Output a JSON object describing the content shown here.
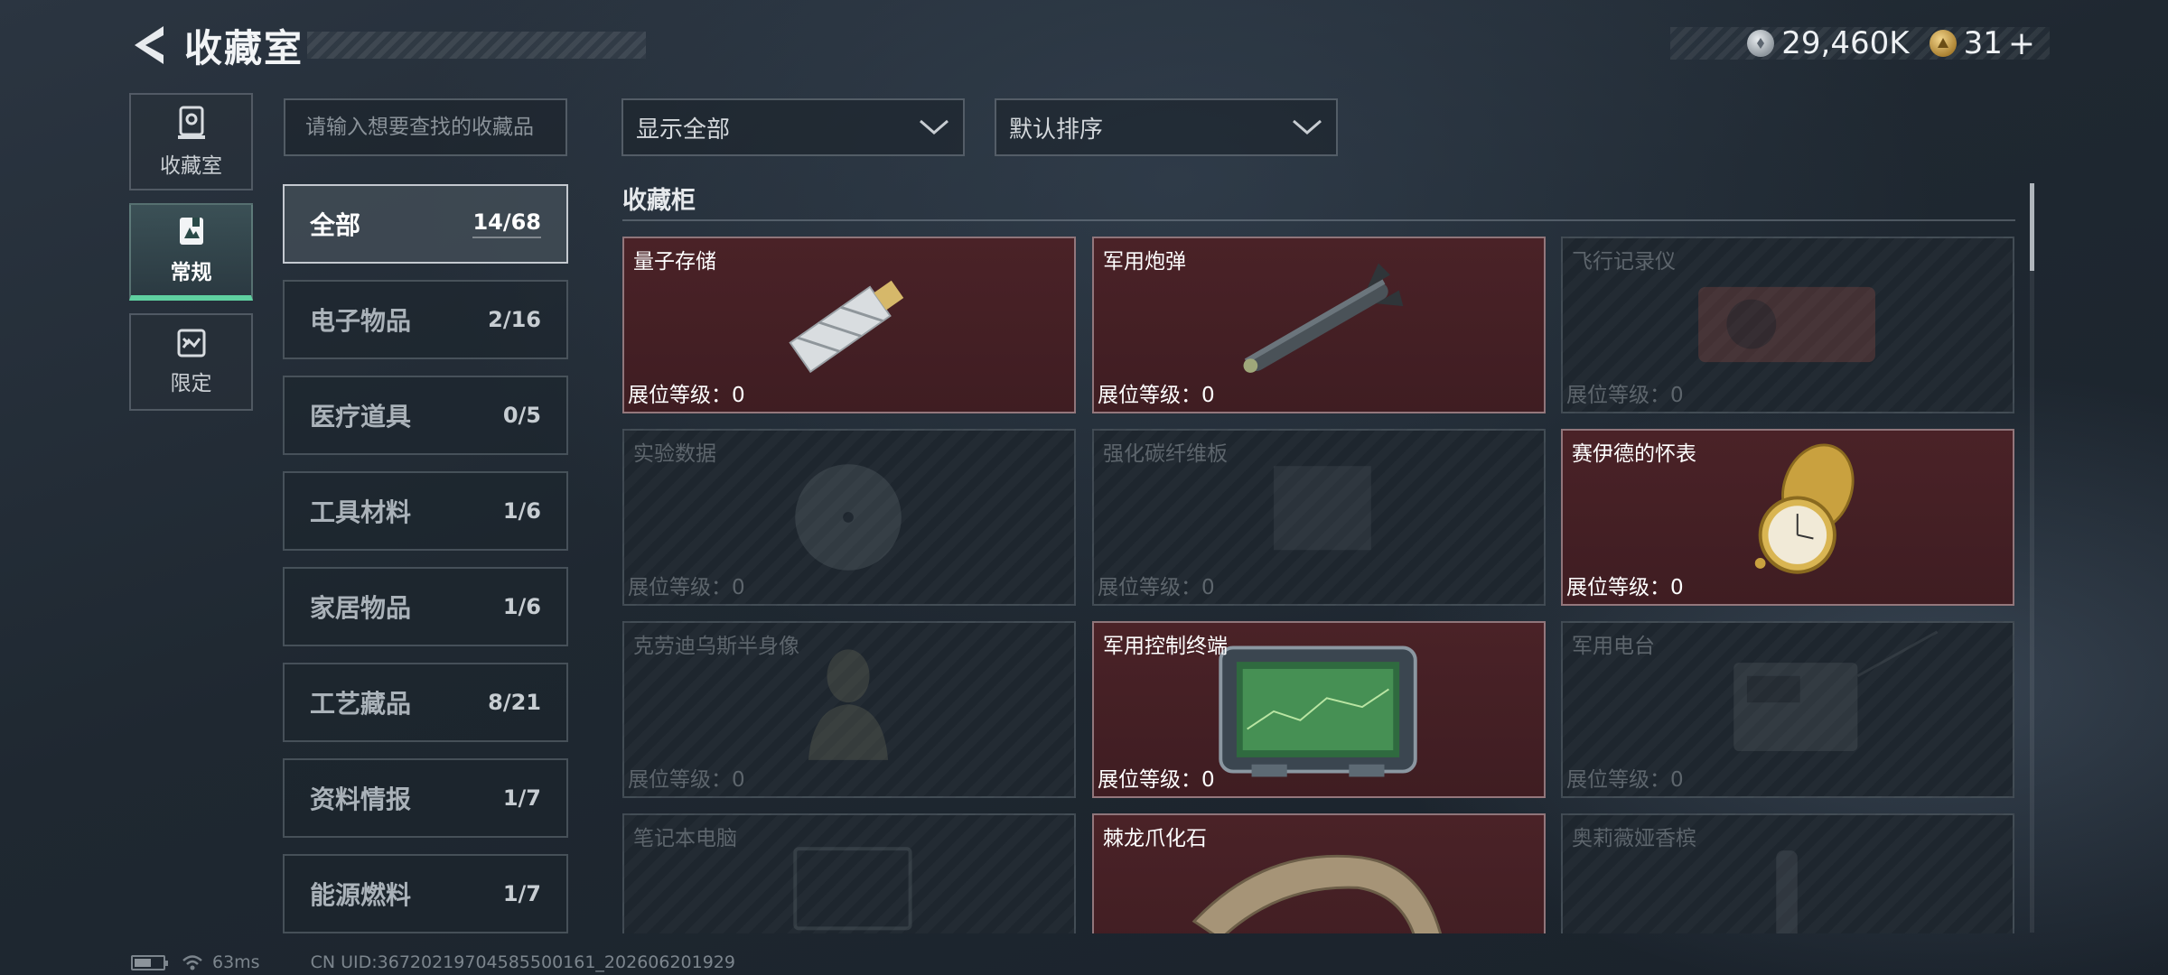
{
  "header": {
    "title": "收藏室",
    "currencies": [
      {
        "icon": "silver-coin-icon",
        "value": "29,460K"
      },
      {
        "icon": "gold-triangle-icon",
        "value": "31"
      }
    ],
    "plus": "+"
  },
  "leftnav": [
    {
      "label": "收藏室",
      "icon": "collection-room-icon",
      "active": false
    },
    {
      "label": "常规",
      "icon": "regular-icon",
      "active": true
    },
    {
      "label": "限定",
      "icon": "limited-icon",
      "active": false
    }
  ],
  "search": {
    "placeholder": "请输入想要查找的收藏品"
  },
  "categories": [
    {
      "name": "全部",
      "count": "14/68",
      "active": true
    },
    {
      "name": "电子物品",
      "count": "2/16"
    },
    {
      "name": "医疗道具",
      "count": "0/5"
    },
    {
      "name": "工具材料",
      "count": "1/6"
    },
    {
      "name": "家居物品",
      "count": "1/6"
    },
    {
      "name": "工艺藏品",
      "count": "8/21"
    },
    {
      "name": "资料情报",
      "count": "1/7"
    },
    {
      "name": "能源燃料",
      "count": "1/7"
    }
  ],
  "filters": {
    "display": "显示全部",
    "sort": "默认排序"
  },
  "section_title": "收藏柜",
  "items": [
    {
      "name": "量子存储",
      "level": "展位等级：0",
      "owned": true,
      "art": "usb-drive"
    },
    {
      "name": "军用炮弹",
      "level": "展位等级：0",
      "owned": true,
      "art": "missile"
    },
    {
      "name": "飞行记录仪",
      "level": "展位等级：0",
      "owned": false,
      "art": "recorder"
    },
    {
      "name": "实验数据",
      "level": "展位等级：0",
      "owned": false,
      "art": "disc"
    },
    {
      "name": "强化碳纤维板",
      "level": "展位等级：0",
      "owned": false,
      "art": "plate"
    },
    {
      "name": "赛伊德的怀表",
      "level": "展位等级：0",
      "owned": true,
      "art": "pocket-watch"
    },
    {
      "name": "克劳迪乌斯半身像",
      "level": "展位等级：0",
      "owned": false,
      "art": "bust"
    },
    {
      "name": "军用控制终端",
      "level": "展位等级：0",
      "owned": true,
      "art": "terminal"
    },
    {
      "name": "军用电台",
      "level": "展位等级：0",
      "owned": false,
      "art": "radio"
    },
    {
      "name": "笔记本电脑",
      "level": "",
      "owned": false,
      "art": "laptop"
    },
    {
      "name": "棘龙爪化石",
      "level": "",
      "owned": true,
      "art": "claw"
    },
    {
      "name": "奥莉薇娅香槟",
      "level": "",
      "owned": false,
      "art": "bottle"
    }
  ],
  "footer": {
    "battery_level": 0.6,
    "ping": "63ms",
    "uid": "CN UID:3672021970458550​0161_202606201929"
  }
}
